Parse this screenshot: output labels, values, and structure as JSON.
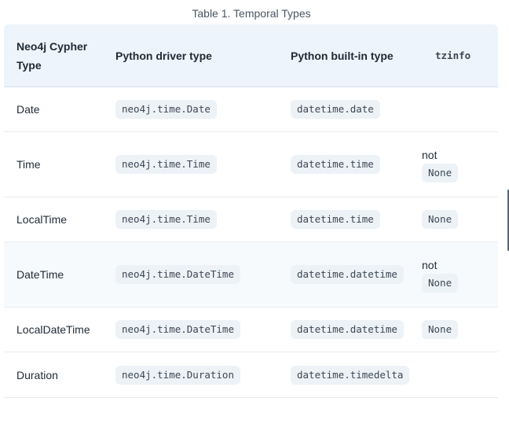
{
  "caption": "Table 1. Temporal Types",
  "headers": {
    "cypher": "Neo4j Cypher Type",
    "driver": "Python driver type",
    "builtin": "Python built-in type",
    "tzinfo": "tzinfo"
  },
  "rows": [
    {
      "cypher": "Date",
      "driver": "neo4j.time.Date",
      "builtin": "datetime.date",
      "tz_prefix": "",
      "tz_code": ""
    },
    {
      "cypher": "Time",
      "driver": "neo4j.time.Time",
      "builtin": "datetime.time",
      "tz_prefix": "not",
      "tz_code": "None"
    },
    {
      "cypher": "LocalTime",
      "driver": "neo4j.time.Time",
      "builtin": "datetime.time",
      "tz_prefix": "",
      "tz_code": "None"
    },
    {
      "cypher": "DateTime",
      "driver": "neo4j.time.DateTime",
      "builtin": "datetime.datetime",
      "tz_prefix": "not",
      "tz_code": "None"
    },
    {
      "cypher": "LocalDateTime",
      "driver": "neo4j.time.DateTime",
      "builtin": "datetime.datetime",
      "tz_prefix": "",
      "tz_code": "None"
    },
    {
      "cypher": "Duration",
      "driver": "neo4j.time.Duration",
      "builtin": "datetime.timedelta",
      "tz_prefix": "",
      "tz_code": ""
    }
  ]
}
